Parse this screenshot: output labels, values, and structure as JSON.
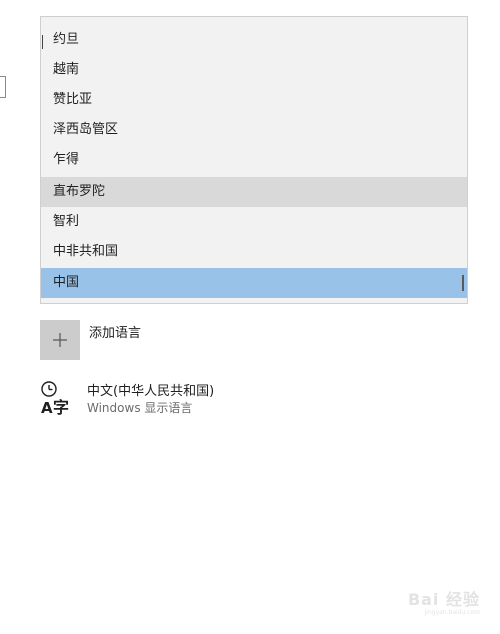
{
  "country_list": {
    "items": [
      {
        "label": "约旦"
      },
      {
        "label": "越南"
      },
      {
        "label": "赞比亚"
      },
      {
        "label": "泽西岛管区"
      },
      {
        "label": "乍得"
      },
      {
        "label": "直布罗陀",
        "state": "hover"
      },
      {
        "label": "智利"
      },
      {
        "label": "中非共和国"
      },
      {
        "label": "中国",
        "state": "selected"
      }
    ],
    "selected_color": "#99c2e8",
    "hover_color": "#d9d9d9"
  },
  "add_language": {
    "icon": "plus-icon",
    "label": "添加语言"
  },
  "languages": [
    {
      "icon": "language-character-icon",
      "name": "中文(中华人民共和国)",
      "subtitle": "Windows 显示语言"
    }
  ],
  "watermark": {
    "logo": "Bai 经验",
    "site": "jingyan.baidu.com"
  }
}
